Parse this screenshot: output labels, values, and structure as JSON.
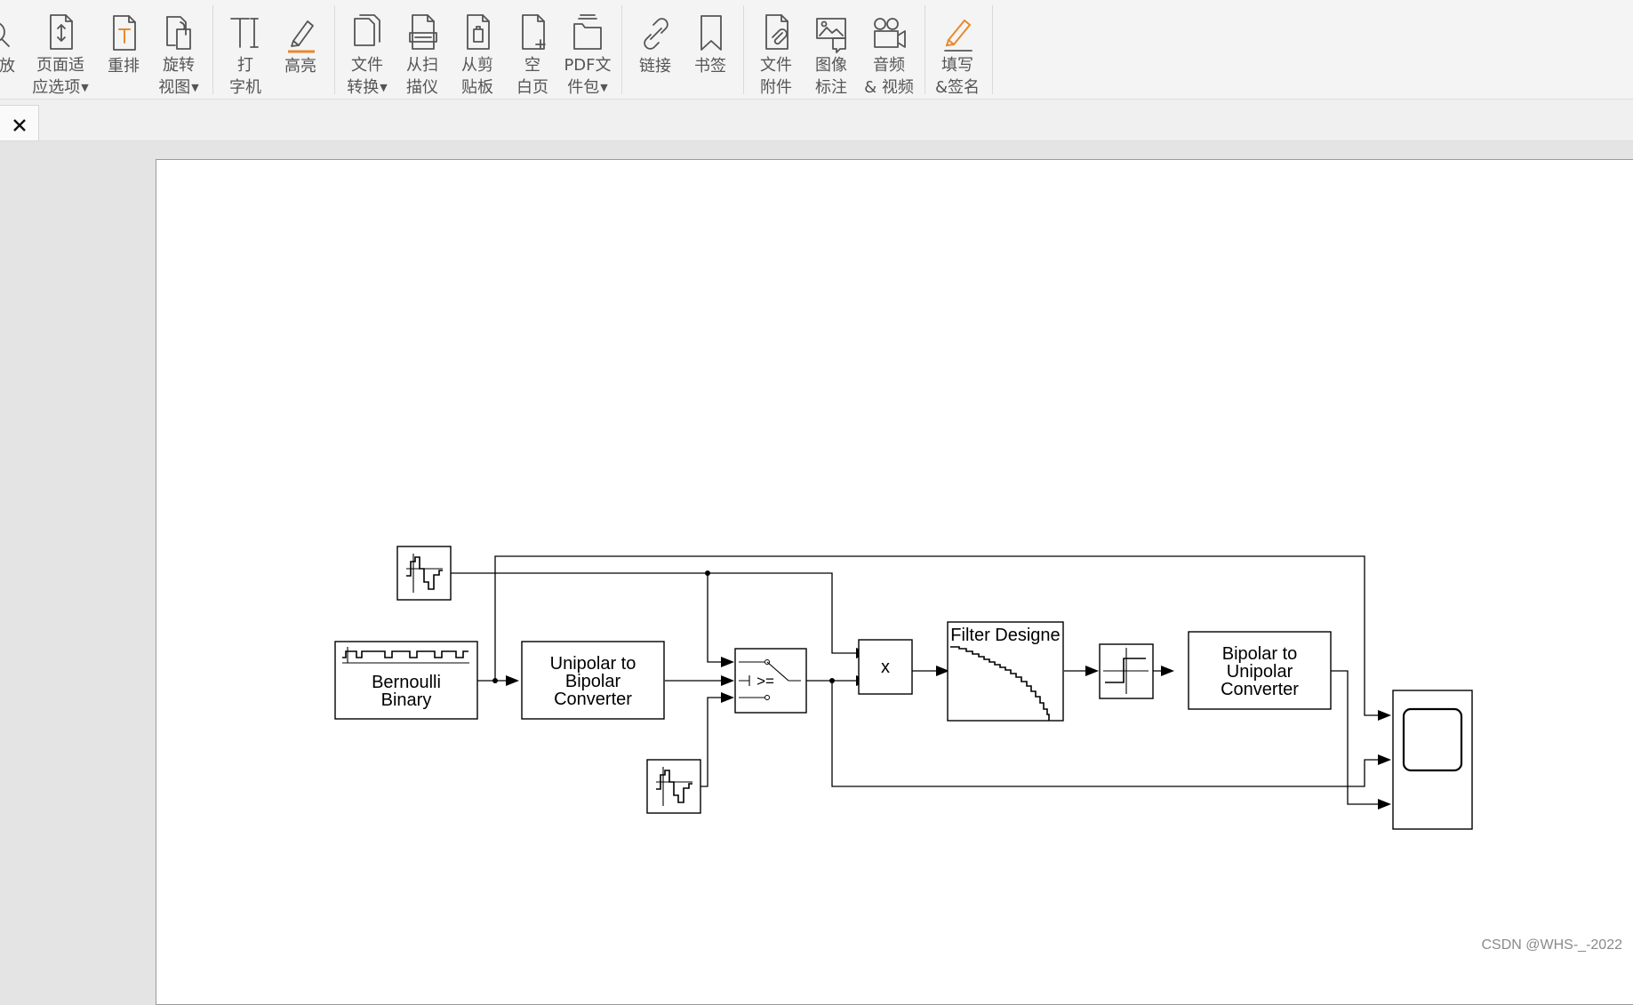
{
  "toolbar": {
    "groups": [
      [
        {
          "id": "zoom",
          "label1": "放",
          "label2": "",
          "dropdown": false
        },
        {
          "id": "fit-page",
          "label1": "页面适",
          "label2": "应选项",
          "dropdown": true
        },
        {
          "id": "reflow",
          "label1": "重排",
          "label2": "",
          "dropdown": false
        },
        {
          "id": "rotate",
          "label1": "旋转",
          "label2": "视图",
          "dropdown": true
        }
      ],
      [
        {
          "id": "typewriter",
          "label1": "打",
          "label2": "字机",
          "dropdown": false
        },
        {
          "id": "highlight",
          "label1": "高亮",
          "label2": "",
          "dropdown": false
        }
      ],
      [
        {
          "id": "convert",
          "label1": "文件",
          "label2": "转换",
          "dropdown": true
        },
        {
          "id": "from-scanner",
          "label1": "从扫",
          "label2": "描仪",
          "dropdown": false
        },
        {
          "id": "from-clipboard",
          "label1": "从剪",
          "label2": "贴板",
          "dropdown": false
        },
        {
          "id": "blank-page",
          "label1": "空",
          "label2": "白页",
          "dropdown": false
        },
        {
          "id": "pdf-portfolio",
          "label1": "PDF文",
          "label2": "件包",
          "dropdown": true
        }
      ],
      [
        {
          "id": "link",
          "label1": "链接",
          "label2": "",
          "dropdown": false
        },
        {
          "id": "bookmark",
          "label1": "书签",
          "label2": "",
          "dropdown": false
        }
      ],
      [
        {
          "id": "attachment",
          "label1": "文件",
          "label2": "附件",
          "dropdown": false
        },
        {
          "id": "image-annotation",
          "label1": "图像",
          "label2": "标注",
          "dropdown": false
        },
        {
          "id": "audio-video",
          "label1": "音频",
          "label2": "& 视频",
          "dropdown": false
        }
      ],
      [
        {
          "id": "fill-sign",
          "label1": "填写",
          "label2": "&签名",
          "dropdown": false
        }
      ]
    ],
    "accent_color": "#e8892b"
  },
  "tab": {
    "close_glyph": "✕"
  },
  "diagram": {
    "blocks": {
      "bernoulli": {
        "line1": "Bernoulli",
        "line2": "Binary"
      },
      "unipolar": {
        "line1": "Unipolar to",
        "line2": "Bipolar",
        "line3": "Converter"
      },
      "switch": {
        "label": ">="
      },
      "product": {
        "label": "x"
      },
      "filter": {
        "label": "Filter Designe"
      },
      "bipolar": {
        "line1": "Bipolar to",
        "line2": "Unipolar",
        "line3": "Converter"
      }
    }
  },
  "watermark": "CSDN @WHS-_-2022"
}
